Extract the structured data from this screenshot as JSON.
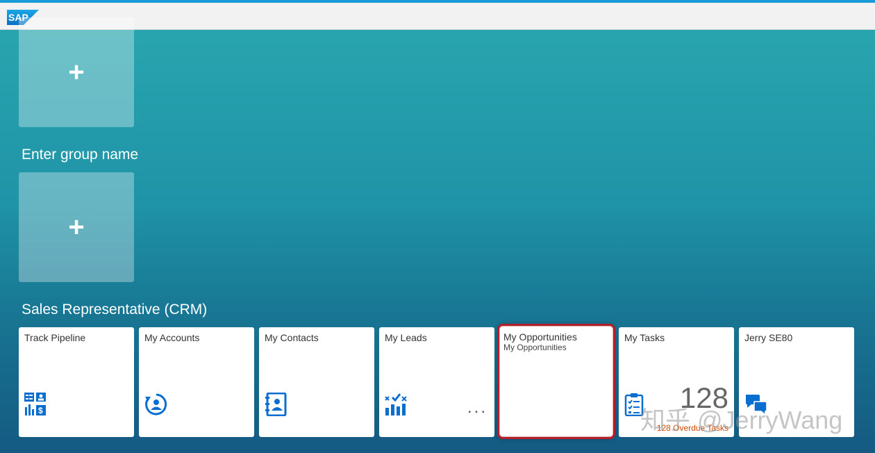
{
  "shell": {
    "logo_text": "SAP"
  },
  "add_tiles": [
    {
      "symbol": "+"
    },
    {
      "symbol": "+"
    }
  ],
  "groups": [
    {
      "title": "Enter group name"
    },
    {
      "title": "Sales Representative (CRM)"
    }
  ],
  "tiles": [
    {
      "title": "Track Pipeline",
      "icon": "pipeline-icon"
    },
    {
      "title": "My Accounts",
      "icon": "account-refresh-icon"
    },
    {
      "title": "My Contacts",
      "icon": "address-book-icon"
    },
    {
      "title": "My Leads",
      "icon": "leads-chart-icon",
      "more": "..."
    },
    {
      "title": "My Opportunities",
      "subtitle": "My Opportunities"
    },
    {
      "title": "My Tasks",
      "icon": "task-list-icon",
      "kpi": "128",
      "footer": "128 Overdue Tasks"
    },
    {
      "title": "Jerry SE80",
      "icon": "chat-icon"
    }
  ],
  "watermark": "知乎 @JerryWang",
  "colors": {
    "accent": "#0a6ed1",
    "highlight": "#b3202b",
    "overdue": "#d14900"
  }
}
